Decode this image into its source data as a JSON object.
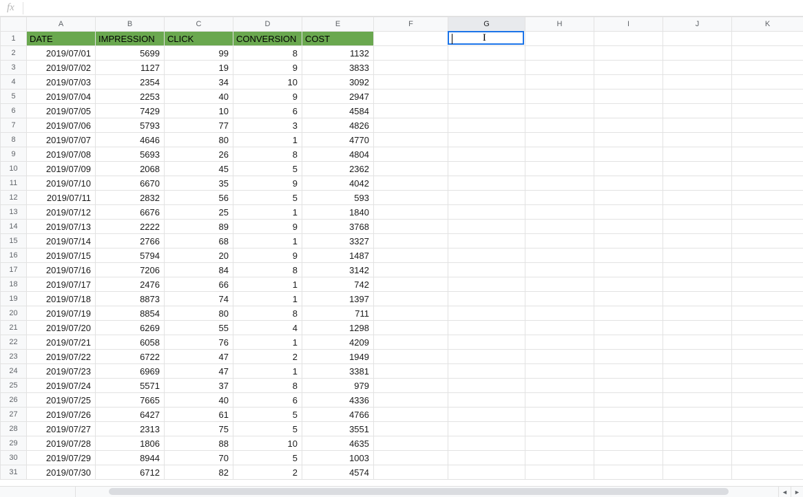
{
  "formula_bar": {
    "fx": "fx",
    "value": ""
  },
  "columns": [
    "A",
    "B",
    "C",
    "D",
    "E",
    "F",
    "G",
    "H",
    "I",
    "J",
    "K"
  ],
  "active_column_index": 6,
  "active_cell": {
    "col": "G",
    "row": 1
  },
  "headers": {
    "A": "DATE",
    "B": "IMPRESSION",
    "C": "CLICK",
    "D": "CONVERSION",
    "E": "COST"
  },
  "rows": [
    {
      "n": 2,
      "A": "2019/07/01",
      "B": 5699,
      "C": 99,
      "D": 8,
      "E": 1132
    },
    {
      "n": 3,
      "A": "2019/07/02",
      "B": 1127,
      "C": 19,
      "D": 9,
      "E": 3833
    },
    {
      "n": 4,
      "A": "2019/07/03",
      "B": 2354,
      "C": 34,
      "D": 10,
      "E": 3092
    },
    {
      "n": 5,
      "A": "2019/07/04",
      "B": 2253,
      "C": 40,
      "D": 9,
      "E": 2947
    },
    {
      "n": 6,
      "A": "2019/07/05",
      "B": 7429,
      "C": 10,
      "D": 6,
      "E": 4584
    },
    {
      "n": 7,
      "A": "2019/07/06",
      "B": 5793,
      "C": 77,
      "D": 3,
      "E": 4826
    },
    {
      "n": 8,
      "A": "2019/07/07",
      "B": 4646,
      "C": 80,
      "D": 1,
      "E": 4770
    },
    {
      "n": 9,
      "A": "2019/07/08",
      "B": 5693,
      "C": 26,
      "D": 8,
      "E": 4804
    },
    {
      "n": 10,
      "A": "2019/07/09",
      "B": 2068,
      "C": 45,
      "D": 5,
      "E": 2362
    },
    {
      "n": 11,
      "A": "2019/07/10",
      "B": 6670,
      "C": 35,
      "D": 9,
      "E": 4042
    },
    {
      "n": 12,
      "A": "2019/07/11",
      "B": 2832,
      "C": 56,
      "D": 5,
      "E": 593
    },
    {
      "n": 13,
      "A": "2019/07/12",
      "B": 6676,
      "C": 25,
      "D": 1,
      "E": 1840
    },
    {
      "n": 14,
      "A": "2019/07/13",
      "B": 2222,
      "C": 89,
      "D": 9,
      "E": 3768
    },
    {
      "n": 15,
      "A": "2019/07/14",
      "B": 2766,
      "C": 68,
      "D": 1,
      "E": 3327
    },
    {
      "n": 16,
      "A": "2019/07/15",
      "B": 5794,
      "C": 20,
      "D": 9,
      "E": 1487
    },
    {
      "n": 17,
      "A": "2019/07/16",
      "B": 7206,
      "C": 84,
      "D": 8,
      "E": 3142
    },
    {
      "n": 18,
      "A": "2019/07/17",
      "B": 2476,
      "C": 66,
      "D": 1,
      "E": 742
    },
    {
      "n": 19,
      "A": "2019/07/18",
      "B": 8873,
      "C": 74,
      "D": 1,
      "E": 1397
    },
    {
      "n": 20,
      "A": "2019/07/19",
      "B": 8854,
      "C": 80,
      "D": 8,
      "E": 711
    },
    {
      "n": 21,
      "A": "2019/07/20",
      "B": 6269,
      "C": 55,
      "D": 4,
      "E": 1298
    },
    {
      "n": 22,
      "A": "2019/07/21",
      "B": 6058,
      "C": 76,
      "D": 1,
      "E": 4209
    },
    {
      "n": 23,
      "A": "2019/07/22",
      "B": 6722,
      "C": 47,
      "D": 2,
      "E": 1949
    },
    {
      "n": 24,
      "A": "2019/07/23",
      "B": 6969,
      "C": 47,
      "D": 1,
      "E": 3381
    },
    {
      "n": 25,
      "A": "2019/07/24",
      "B": 5571,
      "C": 37,
      "D": 8,
      "E": 979
    },
    {
      "n": 26,
      "A": "2019/07/25",
      "B": 7665,
      "C": 40,
      "D": 6,
      "E": 4336
    },
    {
      "n": 27,
      "A": "2019/07/26",
      "B": 6427,
      "C": 61,
      "D": 5,
      "E": 4766
    },
    {
      "n": 28,
      "A": "2019/07/27",
      "B": 2313,
      "C": 75,
      "D": 5,
      "E": 3551
    },
    {
      "n": 29,
      "A": "2019/07/28",
      "B": 1806,
      "C": 88,
      "D": 10,
      "E": 4635
    },
    {
      "n": 30,
      "A": "2019/07/29",
      "B": 8944,
      "C": 70,
      "D": 5,
      "E": 1003
    },
    {
      "n": 31,
      "A": "2019/07/30",
      "B": 6712,
      "C": 82,
      "D": 2,
      "E": 4574
    }
  ],
  "scroll": {
    "left_arrow": "◄",
    "right_arrow": "►"
  }
}
